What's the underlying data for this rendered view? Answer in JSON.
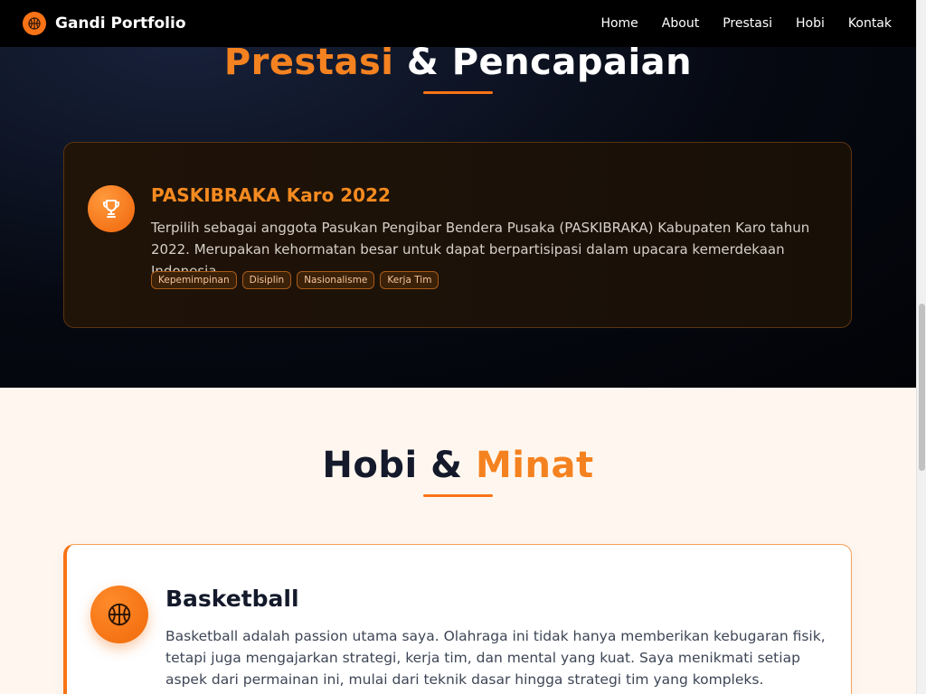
{
  "nav": {
    "brand": "Gandi Portfolio",
    "brand_icon": "basketball-icon",
    "links": [
      "Home",
      "About",
      "Prestasi",
      "Hobi",
      "Kontak"
    ]
  },
  "prestasi": {
    "title_highlight": "Prestasi",
    "title_rest": "& Pencapaian",
    "card": {
      "icon": "trophy-icon",
      "title": "PASKIBRAKA Karo 2022",
      "description": "Terpilih sebagai anggota Pasukan Pengibar Bendera Pusaka (PASKIBRAKA) Kabupaten Karo tahun 2022. Merupakan kehormatan besar untuk dapat berpartisipasi dalam upacara kemerdekaan Indonesia.",
      "tags": [
        "Kepemimpinan",
        "Disiplin",
        "Nasionalisme",
        "Kerja Tim"
      ]
    }
  },
  "hobi": {
    "title_rest": "Hobi &",
    "title_highlight": "Minat",
    "card": {
      "icon": "basketball-icon",
      "title": "Basketball",
      "description": "Basketball adalah passion utama saya. Olahraga ini tidak hanya memberikan kebugaran fisik, tetapi juga mengajarkan strategi, kerja tim, dan mental yang kuat. Saya menikmati setiap aspek dari permainan ini, mulai dari teknik dasar hingga strategi tim yang kompleks."
    }
  },
  "colors": {
    "accent": "#f97316",
    "dark": "#020307",
    "light_bg": "#fff7ef"
  }
}
